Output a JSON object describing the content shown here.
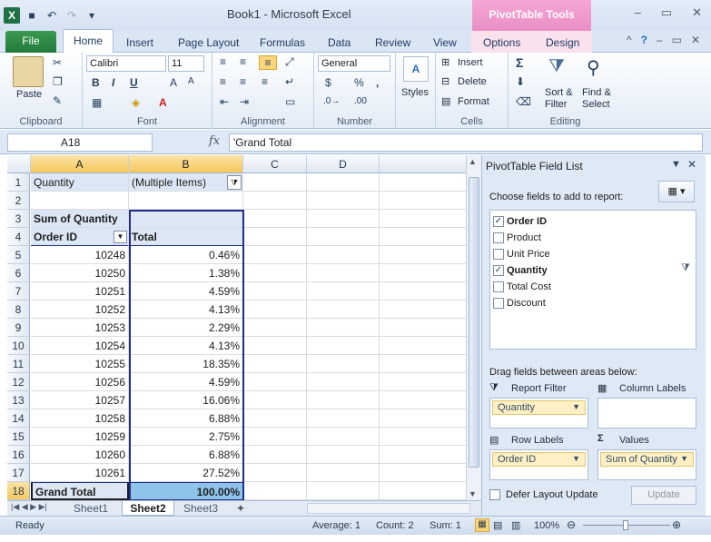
{
  "window": {
    "title": "Book1 - Microsoft Excel",
    "context_tab": "PivotTable Tools"
  },
  "tabs": [
    "File",
    "Home",
    "Insert",
    "Page Layout",
    "Formulas",
    "Data",
    "Review",
    "View",
    "Options",
    "Design"
  ],
  "ribbon": {
    "clipboard": {
      "label": "Clipboard",
      "paste": "Paste"
    },
    "font": {
      "label": "Font",
      "name": "Calibri",
      "size": "11"
    },
    "alignment": {
      "label": "Alignment"
    },
    "number": {
      "label": "Number",
      "format": "General",
      "currency": "$",
      "percent": "%",
      "comma": ","
    },
    "styles": {
      "label": "Styles"
    },
    "cells": {
      "label": "Cells",
      "insert": "Insert",
      "delete": "Delete",
      "format": "Format"
    },
    "editing": {
      "label": "Editing",
      "sort": "Sort &",
      "sort2": "Filter",
      "find": "Find &",
      "find2": "Select"
    }
  },
  "formula_bar": {
    "name_box": "A18",
    "fx": "fx",
    "content": "'Grand Total"
  },
  "columns": [
    "A",
    "B",
    "C",
    "D"
  ],
  "rows": [
    "1",
    "2",
    "3",
    "4",
    "5",
    "6",
    "7",
    "8",
    "9",
    "10",
    "11",
    "12",
    "13",
    "14",
    "15",
    "16",
    "17",
    "18"
  ],
  "sheet": {
    "r1": {
      "a": "Quantity",
      "b": "(Multiple Items)"
    },
    "r3": {
      "a": "Sum of Quantity"
    },
    "r4": {
      "a": "Order ID",
      "b": "Total"
    },
    "data": [
      {
        "id": "10248",
        "pct": "0.46%"
      },
      {
        "id": "10250",
        "pct": "1.38%"
      },
      {
        "id": "10251",
        "pct": "4.59%"
      },
      {
        "id": "10252",
        "pct": "4.13%"
      },
      {
        "id": "10253",
        "pct": "2.29%"
      },
      {
        "id": "10254",
        "pct": "4.13%"
      },
      {
        "id": "10255",
        "pct": "18.35%"
      },
      {
        "id": "10256",
        "pct": "4.59%"
      },
      {
        "id": "10257",
        "pct": "16.06%"
      },
      {
        "id": "10258",
        "pct": "6.88%"
      },
      {
        "id": "10259",
        "pct": "2.75%"
      },
      {
        "id": "10260",
        "pct": "6.88%"
      },
      {
        "id": "10261",
        "pct": "27.52%"
      }
    ],
    "total": {
      "a": "Grand Total",
      "b": "100.00%"
    }
  },
  "sheet_tabs": [
    "Sheet1",
    "Sheet2",
    "Sheet3"
  ],
  "status": {
    "ready": "Ready",
    "average": "Average: 1",
    "count": "Count: 2",
    "sum": "Sum: 1",
    "zoom": "100%"
  },
  "pane": {
    "title": "PivotTable Field List",
    "choose": "Choose fields to add to report:",
    "fields": [
      {
        "name": "Order ID",
        "checked": true
      },
      {
        "name": "Product",
        "checked": false
      },
      {
        "name": "Unit Price",
        "checked": false
      },
      {
        "name": "Quantity",
        "checked": true
      },
      {
        "name": "Total Cost",
        "checked": false
      },
      {
        "name": "Discount",
        "checked": false
      }
    ],
    "drag": "Drag fields between areas below:",
    "report_filter": "Report Filter",
    "column_labels": "Column Labels",
    "row_labels": "Row Labels",
    "values": "Values",
    "filter_item": "Quantity",
    "row_item": "Order ID",
    "value_item": "Sum of Quantity",
    "defer": "Defer Layout Update",
    "update": "Update"
  },
  "colors": {
    "accent": "#1f3b63",
    "selection": "#f5c75c",
    "pivot_border": "#1f2e8a"
  }
}
